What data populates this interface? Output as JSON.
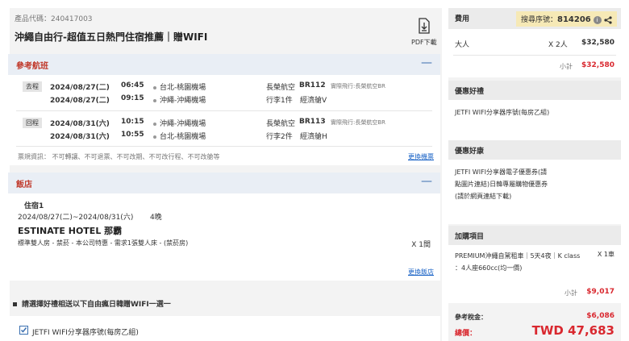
{
  "product": {
    "code_label": "產品代碼：240417003",
    "title": "沖繩自由行-超值五日熱門住宿推薦｜贈WIFI",
    "pdf_label": "PDF下載"
  },
  "flights": {
    "header": "參考航班",
    "collapse": "—",
    "outbound": {
      "tag": "去程",
      "dep_date": "2024/08/27(二)",
      "dep_time": "06:45",
      "dep_airport": "台北-桃園機場",
      "arr_date": "2024/08/27(二)",
      "arr_time": "09:15",
      "arr_airport": "沖繩-沖繩機場",
      "airline": "長榮航空",
      "flight_no": "BR112",
      "actual": "實際飛行:長榮航空BR",
      "baggage": "行李1件",
      "cabin": "經濟艙V"
    },
    "inbound": {
      "tag": "回程",
      "dep_date": "2024/08/31(六)",
      "dep_time": "10:15",
      "dep_airport": "沖繩-沖繩機場",
      "arr_date": "2024/08/31(六)",
      "arr_time": "10:55",
      "arr_airport": "台北-桃園機場",
      "airline": "長榮航空",
      "flight_no": "BR113",
      "actual": "實際飛行:長榮航空BR",
      "baggage": "行李2件",
      "cabin": "經濟艙H"
    },
    "ticket_note": "票規資訊： 不可轉讓、不可退票、不可改期、不可改行程、不可改艙等",
    "change_link": "更換機票"
  },
  "hotel": {
    "header": "飯店",
    "collapse": "—",
    "stay_label": "住宿1",
    "dates": "2024/08/27(二)~2024/08/31(六)",
    "nights": "4晚",
    "name": "ESTINATE HOTEL 那霸",
    "room": "標準雙人房 - 禁菸 - 本公司特惠 - 需求1張雙人床 - (禁菸房)",
    "rooms_count": "X 1間",
    "change_link": "更換飯店"
  },
  "gift_select": {
    "title": "請選擇好禮相送以下自由瘋日韓贈WIFI一選一",
    "option": "JETFI WIFI分享器序號(每房乙組)"
  },
  "summary": {
    "fee_label": "費用",
    "search_label": "搜尋序號：",
    "search_no": "814206",
    "adult_label": "大人",
    "adult_qty": "X 2人",
    "adult_price": "$32,580",
    "subtotal_label": "小計",
    "subtotal": "$32,580",
    "gift_header": "優惠好禮",
    "gift_text": "JETFI WIFI分享器序號(每房乙組)",
    "discount_header": "優惠好康",
    "discount_text": "JETFI WIFI分享器電子優惠券(請點圖片連結)日韓專屬購物優惠券(請於網頁連結下載)",
    "addon_header": "加購項目",
    "addon_text": "PREMIUM沖繩自駕租車｜5天4夜｜K class ：4人座660cc(均一價)",
    "addon_qty": "X 1車",
    "addon_subtotal_label": "小計",
    "addon_subtotal": "$9,017",
    "tax_label": "參考稅金：",
    "tax": "$6,086",
    "total_label": "總價：",
    "total": "TWD 47,683"
  }
}
